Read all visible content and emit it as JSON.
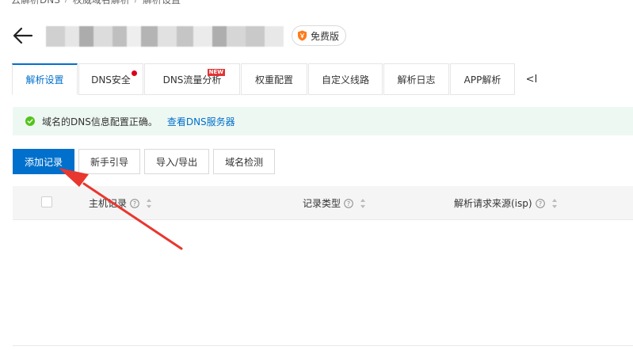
{
  "breadcrumb": [
    "云解析DNS",
    "权威域名解析",
    "解析设置"
  ],
  "header": {
    "domain_obscured": "",
    "badge_label": "免费版"
  },
  "tabs": [
    {
      "label": "解析设置",
      "active": true
    },
    {
      "label": "DNS安全",
      "dot": true
    },
    {
      "label": "DNS流量分析",
      "tag": "NEW"
    },
    {
      "label": "权重配置"
    },
    {
      "label": "自定义线路"
    },
    {
      "label": "解析日志"
    },
    {
      "label": "APP解析"
    }
  ],
  "tabs_more": "<I",
  "alert": {
    "message": "域名的DNS信息配置正确。",
    "link": "查看DNS服务器",
    "color": "#52c41a"
  },
  "toolbar": {
    "add_record": "添加记录",
    "guide": "新手引导",
    "import_export": "导入/导出",
    "domain_check": "域名检测"
  },
  "table": {
    "columns": [
      "主机记录",
      "记录类型",
      "解析请求来源(isp)"
    ]
  },
  "colors": {
    "primary": "#0070cc",
    "alert_bg": "#eef8f2",
    "annotation_arrow": "#e8372f"
  }
}
